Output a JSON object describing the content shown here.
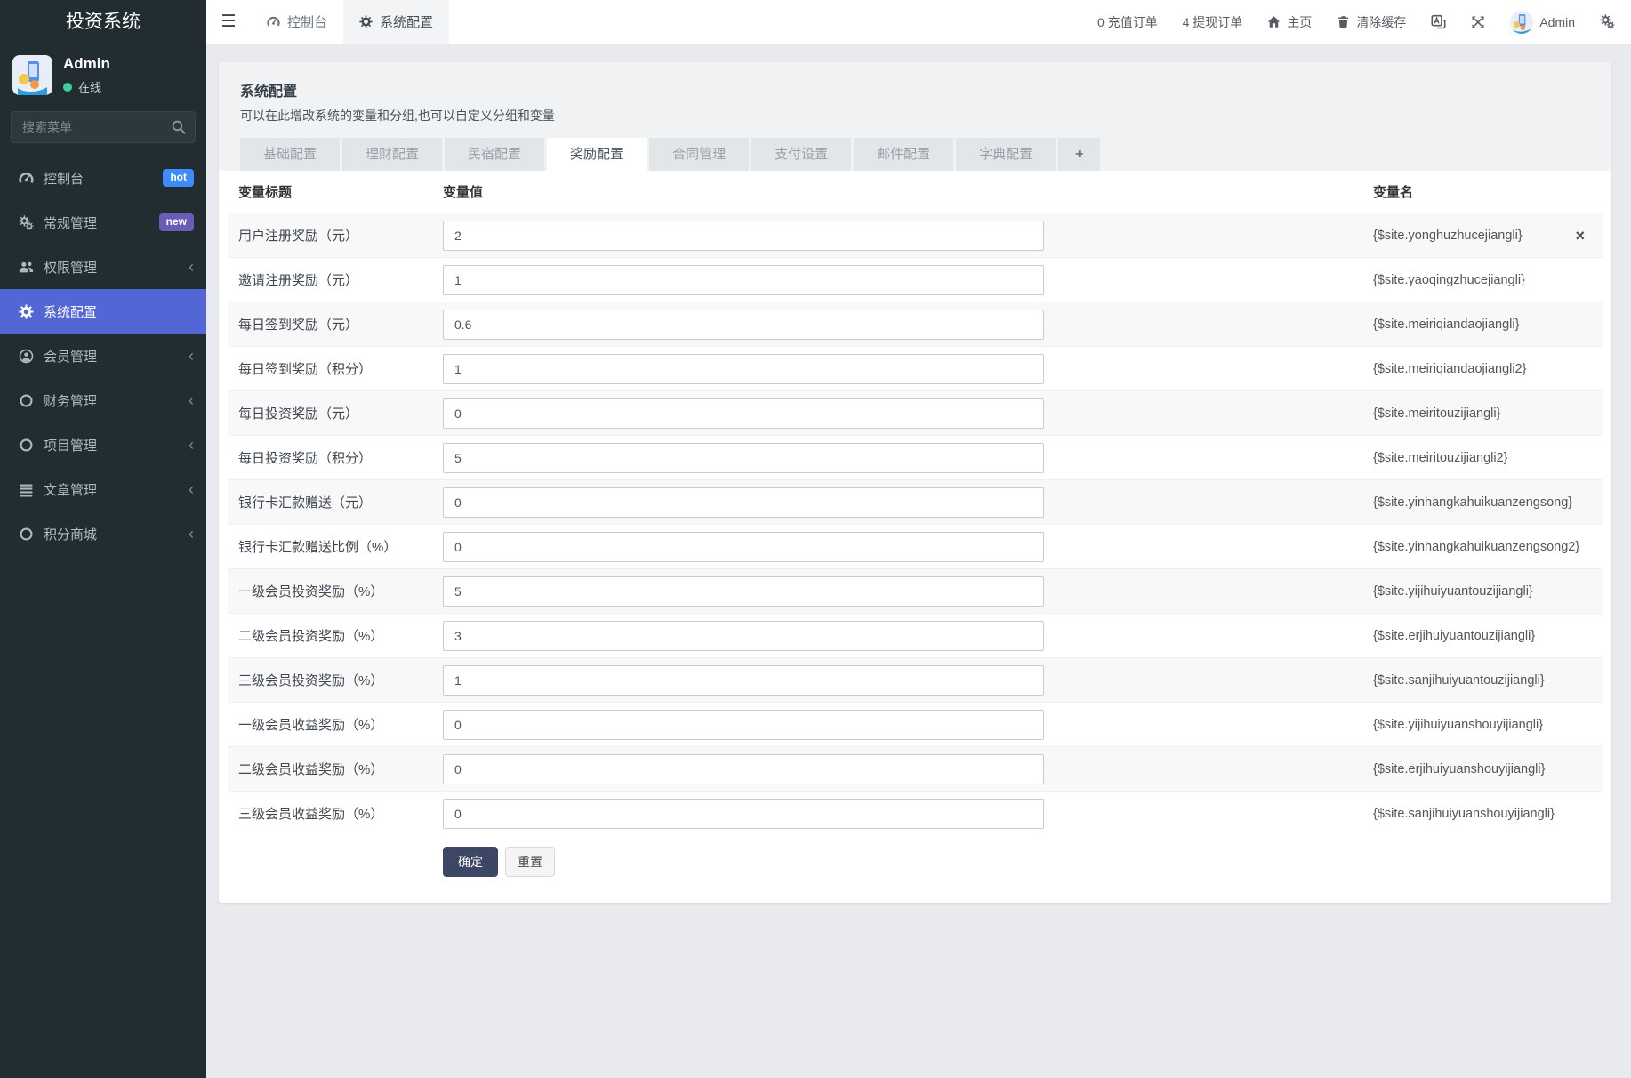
{
  "app": {
    "title": "投资系统"
  },
  "colors": {
    "sidebar_active": "#5266d6",
    "badge_hot": "#3d8bfd",
    "badge_new": "#6a5db8",
    "online_green": "#3fcf9e",
    "submit_button": "#3d4665"
  },
  "sidebar": {
    "user": {
      "name": "Admin",
      "status": "在线"
    },
    "search_placeholder": "搜索菜单",
    "items": [
      {
        "key": "console",
        "label": "控制台",
        "icon": "tachometer-icon",
        "badge": "hot",
        "badge_color": "#3d8bfd"
      },
      {
        "key": "general",
        "label": "常规管理",
        "icon": "gears-icon",
        "badge": "new",
        "badge_color": "#6a5db8"
      },
      {
        "key": "auth",
        "label": "权限管理",
        "icon": "users-icon",
        "chevron": true
      },
      {
        "key": "config",
        "label": "系统配置",
        "icon": "gear-icon",
        "active": true
      },
      {
        "key": "member",
        "label": "会员管理",
        "icon": "user-circle-icon",
        "chevron": true
      },
      {
        "key": "finance",
        "label": "财务管理",
        "icon": "circle-icon",
        "chevron": true
      },
      {
        "key": "project",
        "label": "项目管理",
        "icon": "circle-icon",
        "chevron": true
      },
      {
        "key": "article",
        "label": "文章管理",
        "icon": "list-icon",
        "chevron": true
      },
      {
        "key": "mall",
        "label": "积分商城",
        "icon": "circle-icon",
        "chevron": true
      }
    ]
  },
  "navbar": {
    "tabs": [
      {
        "label": "控制台",
        "icon": "tachometer-icon"
      },
      {
        "label": "系统配置",
        "icon": "gear-icon",
        "active": true
      }
    ],
    "right": {
      "charge": "0 充值订单",
      "withdraw": "4 提现订单",
      "home": "主页",
      "clear_cache": "清除缓存",
      "username": "Admin"
    }
  },
  "page": {
    "title": "系统配置",
    "subtitle": "可以在此增改系统的变量和分组,也可以自定义分组和变量",
    "tabs": [
      "基础配置",
      "理财配置",
      "民宿配置",
      "奖励配置",
      "合同管理",
      "支付设置",
      "邮件配置",
      "字典配置",
      "+"
    ],
    "active_tab": "奖励配置"
  },
  "table": {
    "headers": [
      "变量标题",
      "变量值",
      "变量名"
    ],
    "rows": [
      {
        "title": "用户注册奖励（元）",
        "value": "2",
        "name": "{$site.yonghuzhucejiangli}",
        "closable": true
      },
      {
        "title": "邀请注册奖励（元）",
        "value": "1",
        "name": "{$site.yaoqingzhucejiangli}"
      },
      {
        "title": "每日签到奖励（元）",
        "value": "0.6",
        "name": "{$site.meiriqiandaojiangli}"
      },
      {
        "title": "每日签到奖励（积分）",
        "value": "1",
        "name": "{$site.meiriqiandaojiangli2}"
      },
      {
        "title": "每日投资奖励（元）",
        "value": "0",
        "name": "{$site.meiritouzijiangli}"
      },
      {
        "title": "每日投资奖励（积分）",
        "value": "5",
        "name": "{$site.meiritouzijiangli2}"
      },
      {
        "title": "银行卡汇款赠送（元）",
        "value": "0",
        "name": "{$site.yinhangkahuikuanzengsong}"
      },
      {
        "title": "银行卡汇款赠送比例（%）",
        "value": "0",
        "name": "{$site.yinhangkahuikuanzengsong2}"
      },
      {
        "title": "一级会员投资奖励（%）",
        "value": "5",
        "name": "{$site.yijihuiyuantouzijiangli}"
      },
      {
        "title": "二级会员投资奖励（%）",
        "value": "3",
        "name": "{$site.erjihuiyuantouzijiangli}"
      },
      {
        "title": "三级会员投资奖励（%）",
        "value": "1",
        "name": "{$site.sanjihuiyuantouzijiangli}"
      },
      {
        "title": "一级会员收益奖励（%）",
        "value": "0",
        "name": "{$site.yijihuiyuanshouyijiangli}"
      },
      {
        "title": "二级会员收益奖励（%）",
        "value": "0",
        "name": "{$site.erjihuiyuanshouyijiangli}"
      },
      {
        "title": "三级会员收益奖励（%）",
        "value": "0",
        "name": "{$site.sanjihuiyuanshouyijiangli}"
      }
    ],
    "submit_label": "确定",
    "reset_label": "重置"
  }
}
